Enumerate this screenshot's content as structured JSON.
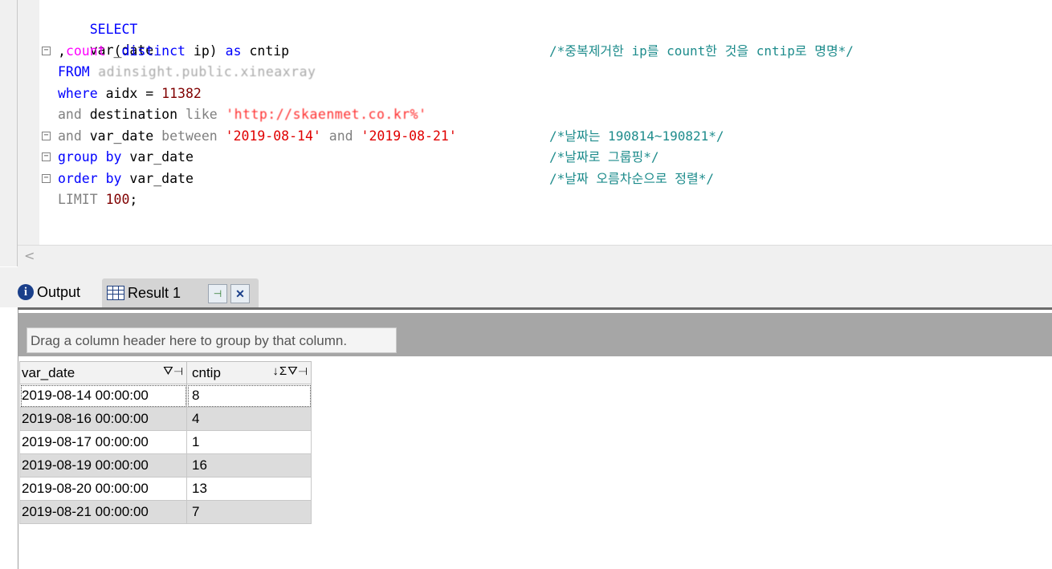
{
  "editor": {
    "lines": [
      {
        "id": "l1",
        "text": "SELECT"
      },
      {
        "id": "l2",
        "text": "var_date"
      },
      {
        "id": "l3",
        "parts": [
          ",",
          "count",
          " (",
          "distinct",
          " ip) ",
          "as",
          " cntip"
        ]
      },
      {
        "id": "l4",
        "parts": [
          "FROM",
          " adinsight.public.xineaxray"
        ]
      },
      {
        "id": "l5",
        "parts": [
          "where",
          " aidx = ",
          "11382"
        ]
      },
      {
        "id": "l6",
        "parts": [
          "and",
          " destination ",
          "like",
          " 'http://skaenmet.co.kr%'"
        ]
      },
      {
        "id": "l7",
        "parts": [
          "and",
          " var_date ",
          "between",
          " ",
          "'2019-08-14'",
          " ",
          "and",
          " ",
          "'2019-08-21'"
        ]
      },
      {
        "id": "l8",
        "parts": [
          "group by",
          " var_date"
        ]
      },
      {
        "id": "l9",
        "parts": [
          "order by",
          " var_date"
        ]
      },
      {
        "id": "l10",
        "parts": [
          "LIMIT",
          " ",
          "100",
          ";"
        ]
      }
    ],
    "comments": {
      "c3": "/*중복제거한 ip를 count한 것을 cntip로 명명*/",
      "c7": "/*날짜는 190814~190821*/",
      "c8": "/*날짜로 그룹핑*/",
      "c9": "/*날짜 오름차순으로 정렬*/"
    },
    "fold_marker": "−",
    "scroll_left": "<"
  },
  "tabs": {
    "output_label": "Output",
    "result_label": "Result 1",
    "pin_symbol": "⊣",
    "close_symbol": "✕"
  },
  "results": {
    "group_hint": "Drag a column header here to group by that column.",
    "columns": [
      {
        "label": "var_date",
        "icons": "⛛⊣"
      },
      {
        "label": "cntip",
        "icons": "↓Σ⛛⊣"
      }
    ],
    "rows": [
      [
        "2019-08-14 00:00:00",
        "8"
      ],
      [
        "2019-08-16 00:00:00",
        "4"
      ],
      [
        "2019-08-17 00:00:00",
        "1"
      ],
      [
        "2019-08-19 00:00:00",
        "16"
      ],
      [
        "2019-08-20 00:00:00",
        "13"
      ],
      [
        "2019-08-21 00:00:00",
        "7"
      ]
    ]
  },
  "colors": {
    "keyword": "#0000ff",
    "keyword_gray": "#808080",
    "function": "#ff00ff",
    "string": "#e00000",
    "number": "#800000",
    "comment": "#1e8c8c",
    "row_alt": "#dcdcdc"
  }
}
